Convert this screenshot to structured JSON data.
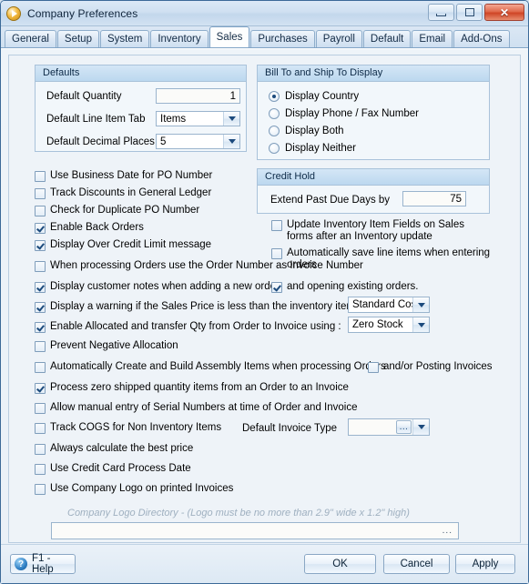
{
  "window": {
    "title": "Company Preferences",
    "icon": "play-circle-icon",
    "controls": {
      "minimize": "minimize-icon",
      "restore": "restore-icon",
      "close": "close-icon"
    }
  },
  "tabs": [
    {
      "label": "General",
      "active": false
    },
    {
      "label": "Setup",
      "active": false
    },
    {
      "label": "System",
      "active": false
    },
    {
      "label": "Inventory",
      "active": false
    },
    {
      "label": "Sales",
      "active": true
    },
    {
      "label": "Purchases",
      "active": false
    },
    {
      "label": "Payroll",
      "active": false
    },
    {
      "label": "Default",
      "active": false
    },
    {
      "label": "Email",
      "active": false
    },
    {
      "label": "Add-Ons",
      "active": false
    }
  ],
  "defaults_group": {
    "title": "Defaults",
    "quantity_label": "Default Quantity",
    "quantity_value": "1",
    "line_item_tab_label": "Default Line Item Tab",
    "line_item_tab_value": "Items",
    "decimal_places_label": "Default Decimal Places",
    "decimal_places_value": "5"
  },
  "bill_ship_group": {
    "title": "Bill To and Ship To Display",
    "options": [
      {
        "label": "Display Country",
        "selected": true
      },
      {
        "label": "Display Phone / Fax Number",
        "selected": false
      },
      {
        "label": "Display Both",
        "selected": false
      },
      {
        "label": "Display Neither",
        "selected": false
      }
    ]
  },
  "credit_hold_group": {
    "title": "Credit Hold",
    "extend_label": "Extend Past Due Days by",
    "extend_value": "75"
  },
  "right_checkboxes": [
    {
      "label": "Update Inventory Item Fields on Sales forms after an Inventory update",
      "checked": false
    },
    {
      "label": "Automatically save line items when entering orders",
      "checked": false
    }
  ],
  "left_checkboxes": [
    {
      "label": "Use Business Date for PO Number",
      "checked": false
    },
    {
      "label": "Track Discounts in General Ledger",
      "checked": false
    },
    {
      "label": "Check for Duplicate PO Number",
      "checked": false
    },
    {
      "label": "Enable Back Orders",
      "checked": true
    },
    {
      "label": "Display Over Credit Limit message",
      "checked": true
    },
    {
      "label": "When processing Orders use the Order Number as Invoice Number",
      "checked": false
    },
    {
      "label": "Display customer notes when adding a new order",
      "checked": true
    },
    {
      "label": "Display a warning if the Sales Price is less than the inventory items",
      "checked": true
    },
    {
      "label": "Enable Allocated and transfer Qty from Order to Invoice using :",
      "checked": true
    },
    {
      "label": "Prevent Negative Allocation",
      "checked": false
    },
    {
      "label": "Automatically Create and Build Assembly Items when processing Orders",
      "checked": false
    },
    {
      "label": "Process zero shipped quantity items from an Order to an Invoice",
      "checked": true
    },
    {
      "label": "Allow manual entry of Serial Numbers at time of Order and Invoice",
      "checked": false
    },
    {
      "label": "Track COGS for Non Inventory Items",
      "checked": false
    },
    {
      "label": "Always calculate the best price",
      "checked": false
    },
    {
      "label": "Use Credit Card Process Date",
      "checked": false
    },
    {
      "label": "Use Company Logo on printed Invoices",
      "checked": false
    }
  ],
  "inline_checkboxes": {
    "opening_existing_orders": {
      "label": "and opening existing orders.",
      "checked": true
    },
    "posting_invoices": {
      "label": "and/or Posting Invoices",
      "checked": false
    }
  },
  "dropdowns": {
    "sales_price_basis": "Standard Cost",
    "allocation_basis": "Zero Stock",
    "default_invoice_type_label": "Default Invoice Type",
    "default_invoice_type_value": ""
  },
  "logo": {
    "hint": "Company Logo Directory - (Logo must be no more than 2.9\" wide x 1.2\" high)",
    "path_value": "",
    "browse_label": "..."
  },
  "footer": {
    "help_label": "F1 - Help",
    "ok_label": "OK",
    "cancel_label": "Cancel",
    "apply_label": "Apply"
  }
}
